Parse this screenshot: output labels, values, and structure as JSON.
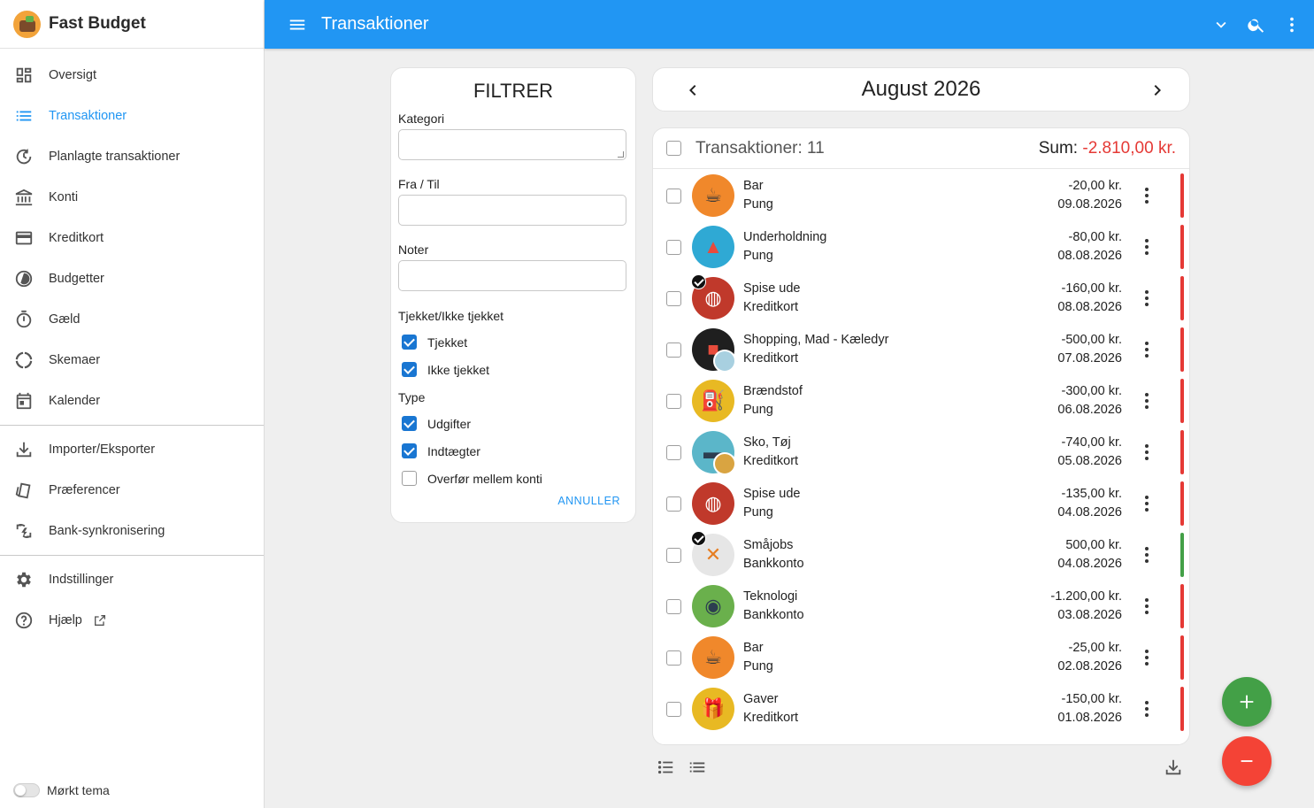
{
  "app": {
    "name": "Fast Budget"
  },
  "topbar": {
    "title": "Transaktioner",
    "icons": [
      "menu-icon",
      "chevron-down-icon",
      "search-icon",
      "more-vert-icon"
    ]
  },
  "sidebar": {
    "items": [
      {
        "label": "Oversigt",
        "icon": "dashboard-icon"
      },
      {
        "label": "Transaktioner",
        "icon": "list-icon",
        "active": true
      },
      {
        "label": "Planlagte transaktioner",
        "icon": "history-icon"
      },
      {
        "label": "Konti",
        "icon": "bank-icon"
      },
      {
        "label": "Kreditkort",
        "icon": "credit-card-icon"
      },
      {
        "label": "Budgetter",
        "icon": "pie-icon"
      },
      {
        "label": "Gæld",
        "icon": "timer-icon"
      },
      {
        "label": "Skemaer",
        "icon": "chart-ring-icon"
      },
      {
        "label": "Kalender",
        "icon": "calendar-icon"
      }
    ],
    "items2": [
      {
        "label": "Importer/Eksporter",
        "icon": "download-icon"
      },
      {
        "label": "Præferencer",
        "icon": "cards-icon"
      },
      {
        "label": "Bank-synkronisering",
        "icon": "sync-icon"
      }
    ],
    "items3": [
      {
        "label": "Indstillinger",
        "icon": "gear-icon"
      },
      {
        "label": "Hjælp",
        "icon": "help-icon"
      }
    ],
    "theme_label": "Mørkt tema"
  },
  "filter": {
    "title": "FILTRER",
    "category_label": "Kategori",
    "from_to_label": "Fra / Til",
    "notes_label": "Noter",
    "checked_section": "Tjekket/Ikke tjekket",
    "checked_label": "Tjekket",
    "unchecked_label": "Ikke tjekket",
    "type_section": "Type",
    "expenses_label": "Udgifter",
    "income_label": "Indtægter",
    "transfer_label": "Overfør mellem konti",
    "cancel_label": "ANNULLER"
  },
  "month": {
    "title": "August 2026"
  },
  "transactions": {
    "count_label": "Transaktioner: 11",
    "sum_label": "Sum:",
    "sum_value": "-2.810,00 kr.",
    "rows": [
      {
        "category": "Bar",
        "account": "Pung",
        "amount": "-20,00 kr.",
        "date": "09.08.2026",
        "type": "expense",
        "checked": false
      },
      {
        "category": "Underholdning",
        "account": "Pung",
        "amount": "-80,00 kr.",
        "date": "08.08.2026",
        "type": "expense",
        "checked": false
      },
      {
        "category": "Spise ude",
        "account": "Kreditkort",
        "amount": "-160,00 kr.",
        "date": "08.08.2026",
        "type": "expense",
        "checked": true
      },
      {
        "category": "Shopping, Mad - Kæledyr",
        "account": "Kreditkort",
        "amount": "-500,00 kr.",
        "date": "07.08.2026",
        "type": "expense",
        "checked": false
      },
      {
        "category": "Brændstof",
        "account": "Pung",
        "amount": "-300,00 kr.",
        "date": "06.08.2026",
        "type": "expense",
        "checked": false
      },
      {
        "category": "Sko, Tøj",
        "account": "Kreditkort",
        "amount": "-740,00 kr.",
        "date": "05.08.2026",
        "type": "expense",
        "checked": false
      },
      {
        "category": "Spise ude",
        "account": "Pung",
        "amount": "-135,00 kr.",
        "date": "04.08.2026",
        "type": "expense",
        "checked": false
      },
      {
        "category": "Småjobs",
        "account": "Bankkonto",
        "amount": "500,00 kr.",
        "date": "04.08.2026",
        "type": "income",
        "checked": true
      },
      {
        "category": "Teknologi",
        "account": "Bankkonto",
        "amount": "-1.200,00 kr.",
        "date": "03.08.2026",
        "type": "expense",
        "checked": false
      },
      {
        "category": "Bar",
        "account": "Pung",
        "amount": "-25,00 kr.",
        "date": "02.08.2026",
        "type": "expense",
        "checked": false
      },
      {
        "category": "Gaver",
        "account": "Kreditkort",
        "amount": "-150,00 kr.",
        "date": "01.08.2026",
        "type": "expense",
        "checked": false
      }
    ]
  },
  "colors": {
    "accent": "#2196f3",
    "expense": "#e53935",
    "income": "#43a047",
    "fab_add": "#43a047",
    "fab_sub": "#f44336"
  }
}
